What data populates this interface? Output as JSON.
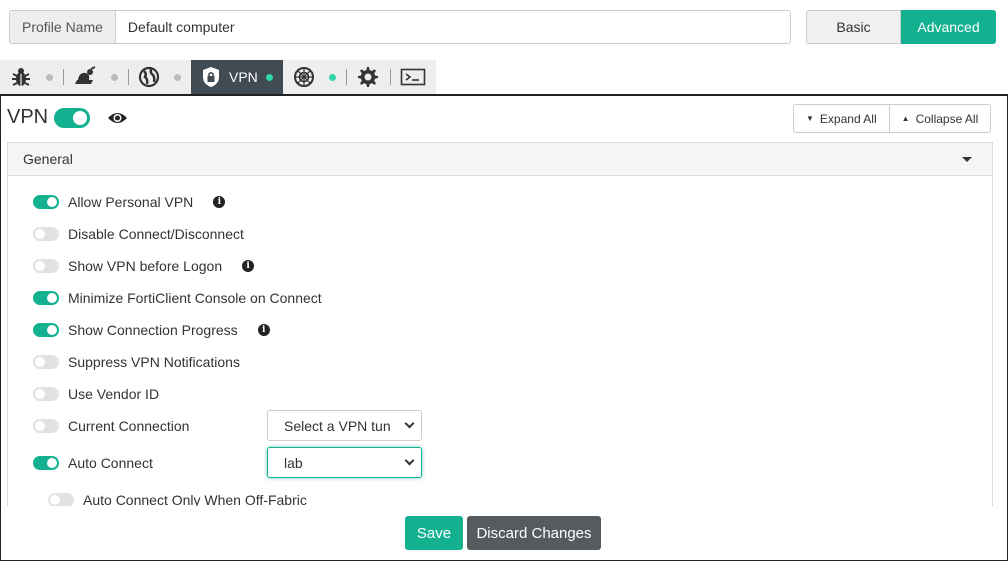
{
  "header": {
    "profile_label": "Profile Name",
    "profile_value": "Default computer",
    "mode_basic": "Basic",
    "mode_advanced": "Advanced"
  },
  "tabs": [
    {
      "icon": "bug-icon",
      "dot": "off"
    },
    {
      "icon": "web-filter-icon",
      "dot": "off"
    },
    {
      "icon": "globe-icon",
      "dot": "off"
    },
    {
      "icon": "shield-lock-icon",
      "label": "VPN",
      "dot": "on",
      "active": true
    },
    {
      "icon": "sandbox-icon",
      "dot": "on"
    },
    {
      "icon": "gear-icon"
    },
    {
      "icon": "terminal-icon"
    }
  ],
  "section": {
    "title": "VPN",
    "enabled": true,
    "expand_all": "Expand All",
    "collapse_all": "Collapse All"
  },
  "panel": {
    "title": "General",
    "settings": [
      {
        "label": "Allow Personal VPN",
        "on": true,
        "info": true
      },
      {
        "label": "Disable Connect/Disconnect",
        "on": false
      },
      {
        "label": "Show VPN before Logon",
        "on": false,
        "info": true
      },
      {
        "label": "Minimize FortiClient Console on Connect",
        "on": true
      },
      {
        "label": "Show Connection Progress",
        "on": true,
        "info": true
      },
      {
        "label": "Suppress VPN Notifications",
        "on": false
      },
      {
        "label": "Use Vendor ID",
        "on": false
      },
      {
        "label": "Current Connection",
        "on": false,
        "select": "Select a VPN tun"
      },
      {
        "label": "Auto Connect",
        "on": true,
        "select": "lab"
      },
      {
        "label": "Auto Connect Only When Off-Fabric",
        "on": false
      }
    ]
  },
  "footer": {
    "save": "Save",
    "discard": "Discard Changes"
  },
  "colors": {
    "accent": "#13b190",
    "tab_active_bg": "#414b54",
    "discard_bg": "#555b5e"
  }
}
